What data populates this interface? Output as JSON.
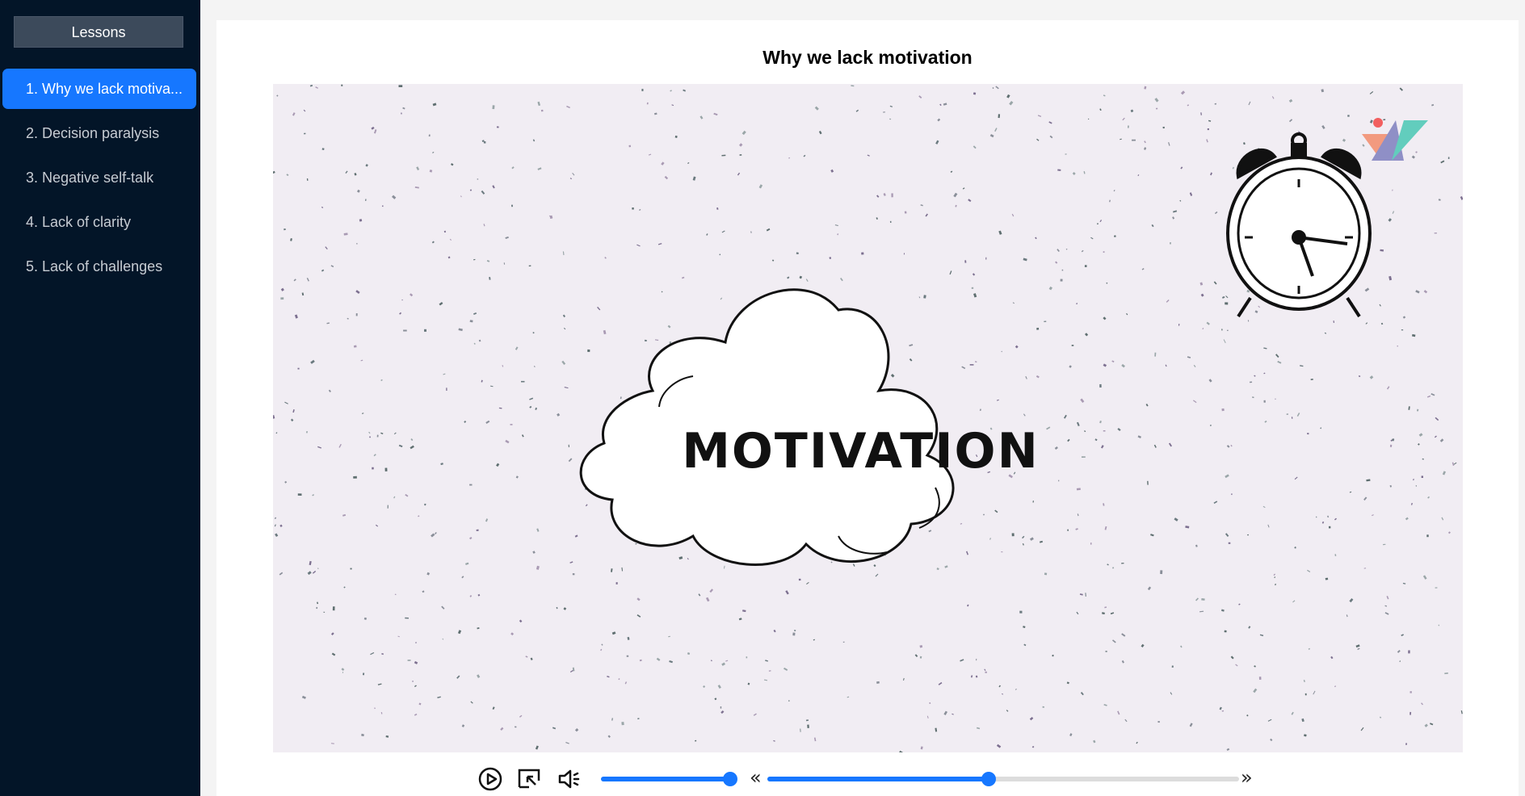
{
  "sidebar": {
    "header": "Lessons",
    "items": [
      {
        "label": "1. Why we lack motiva...",
        "active": true
      },
      {
        "label": "2. Decision paralysis",
        "active": false
      },
      {
        "label": "3. Negative self-talk",
        "active": false
      },
      {
        "label": "4. Lack of clarity",
        "active": false
      },
      {
        "label": "5. Lack of challenges",
        "active": false
      }
    ]
  },
  "main": {
    "title": "Why we lack motivation",
    "video": {
      "center_text": "MOTIVATION",
      "decorations": [
        "cloud-illustration",
        "alarm-clock-illustration",
        "brand-logo"
      ]
    },
    "controls": {
      "play_icon": "play-icon",
      "pip_icon": "picture-in-picture-icon",
      "volume_icon": "volume-icon",
      "volume_level": 1.0,
      "rewind_label": "«",
      "forward_label": "»",
      "progress": 0.47
    }
  },
  "colors": {
    "accent": "#1677ff",
    "sidebar_bg": "#031528",
    "video_bg": "#f1edf3"
  }
}
